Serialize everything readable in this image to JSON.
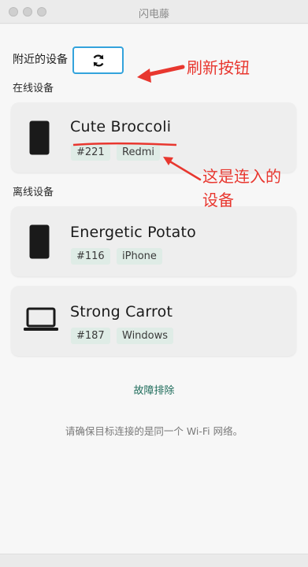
{
  "window": {
    "title": "闪电藤"
  },
  "nearby": {
    "label": "附近的设备",
    "refresh_icon": "refresh-icon"
  },
  "sections": {
    "online": "在线设备",
    "offline": "离线设备"
  },
  "devices": [
    {
      "name": "Cute Broccoli",
      "id": "#221",
      "type": "Redmi",
      "icon": "phone-icon"
    },
    {
      "name": "Energetic Potato",
      "id": "#116",
      "type": "iPhone",
      "icon": "phone-icon"
    },
    {
      "name": "Strong Carrot",
      "id": "#187",
      "type": "Windows",
      "icon": "laptop-icon"
    }
  ],
  "troubleshoot": "故障排除",
  "hint": "请确保目标连接的是同一个 Wi-Fi 网络。",
  "annotations": {
    "refresh": "刷新按钮",
    "connected_line1": "这是连入的",
    "connected_line2": "设备"
  },
  "colors": {
    "annotation": "#e8372f",
    "highlight_border": "#33a3dc",
    "chip_bg": "#dfece6",
    "link": "#1d6b5a"
  }
}
